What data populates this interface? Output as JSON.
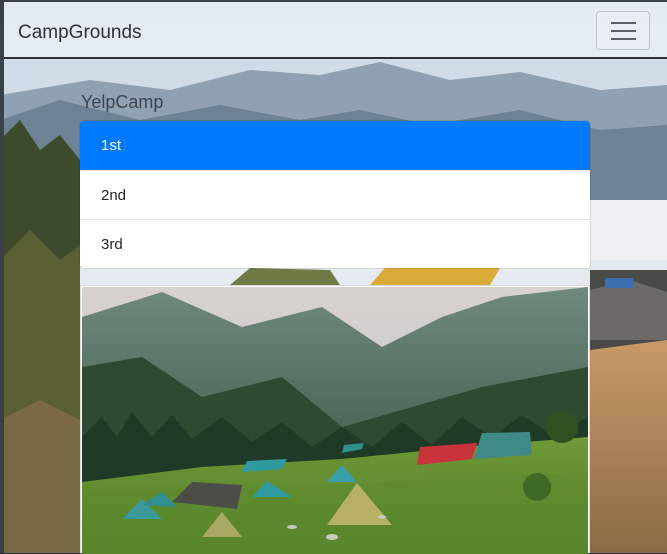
{
  "navbar": {
    "brand": "CampGrounds",
    "toggler_icon": "hamburger-menu-icon"
  },
  "sidebar": {
    "title": "YelpCamp",
    "items": [
      {
        "label": "1st",
        "active": true
      },
      {
        "label": "2nd",
        "active": false
      },
      {
        "label": "3rd",
        "active": false
      }
    ]
  },
  "colors": {
    "active_item": "#007bff",
    "navbar_bg": "#ebf0f6"
  }
}
